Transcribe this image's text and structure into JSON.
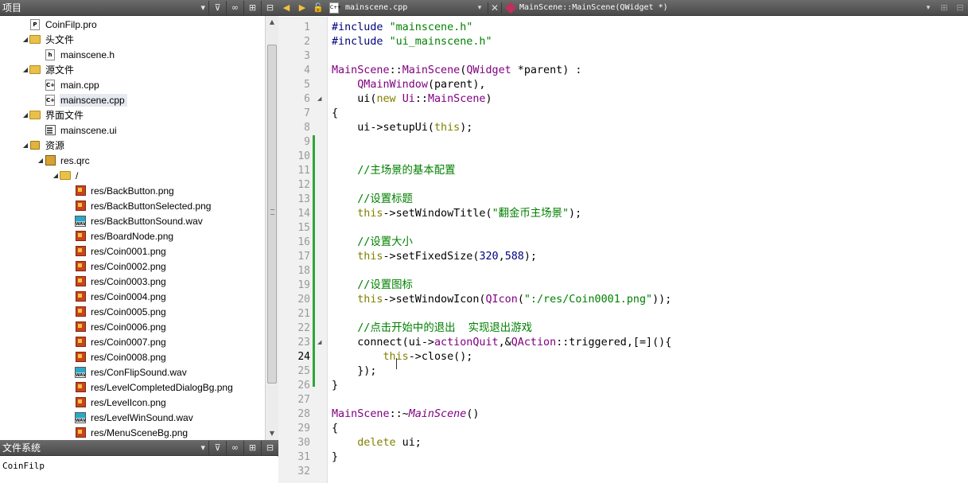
{
  "left_panel": {
    "project_title": "项目",
    "filesystem_title": "文件系统",
    "filesystem_path": "CoinFilp",
    "tree": [
      {
        "label": "CoinFilp.pro",
        "icon": "pro-file-icon",
        "depth": 0,
        "arrow": ""
      },
      {
        "label": "头文件",
        "icon": "header-folder-icon",
        "depth": 0,
        "arrow": "▲"
      },
      {
        "label": "mainscene.h",
        "icon": "header-file-icon",
        "depth": 1,
        "arrow": ""
      },
      {
        "label": "源文件",
        "icon": "source-folder-icon",
        "depth": 0,
        "arrow": "▲"
      },
      {
        "label": "main.cpp",
        "icon": "cpp-file-icon",
        "depth": 1,
        "arrow": ""
      },
      {
        "label": "mainscene.cpp",
        "icon": "cpp-file-icon",
        "depth": 1,
        "arrow": "",
        "selected": true
      },
      {
        "label": "界面文件",
        "icon": "forms-folder-icon",
        "depth": 0,
        "arrow": "▲"
      },
      {
        "label": "mainscene.ui",
        "icon": "ui-file-icon",
        "depth": 1,
        "arrow": ""
      },
      {
        "label": "资源",
        "icon": "resources-folder-icon",
        "depth": 0,
        "arrow": "▲"
      },
      {
        "label": "res.qrc",
        "icon": "qrc-file-icon",
        "depth": 1,
        "arrow": "▲"
      },
      {
        "label": "/",
        "icon": "folder-icon",
        "depth": 2,
        "arrow": "▲"
      },
      {
        "label": "res/BackButton.png",
        "icon": "png-file-icon",
        "depth": 3,
        "arrow": ""
      },
      {
        "label": "res/BackButtonSelected.png",
        "icon": "png-file-icon",
        "depth": 3,
        "arrow": ""
      },
      {
        "label": "res/BackButtonSound.wav",
        "icon": "wav-file-icon",
        "depth": 3,
        "arrow": ""
      },
      {
        "label": "res/BoardNode.png",
        "icon": "png-file-icon",
        "depth": 3,
        "arrow": ""
      },
      {
        "label": "res/Coin0001.png",
        "icon": "png-file-icon",
        "depth": 3,
        "arrow": ""
      },
      {
        "label": "res/Coin0002.png",
        "icon": "png-file-icon",
        "depth": 3,
        "arrow": ""
      },
      {
        "label": "res/Coin0003.png",
        "icon": "png-file-icon",
        "depth": 3,
        "arrow": ""
      },
      {
        "label": "res/Coin0004.png",
        "icon": "png-file-icon",
        "depth": 3,
        "arrow": ""
      },
      {
        "label": "res/Coin0005.png",
        "icon": "png-file-icon",
        "depth": 3,
        "arrow": ""
      },
      {
        "label": "res/Coin0006.png",
        "icon": "png-file-icon",
        "depth": 3,
        "arrow": ""
      },
      {
        "label": "res/Coin0007.png",
        "icon": "png-file-icon",
        "depth": 3,
        "arrow": ""
      },
      {
        "label": "res/Coin0008.png",
        "icon": "png-file-icon",
        "depth": 3,
        "arrow": ""
      },
      {
        "label": "res/ConFlipSound.wav",
        "icon": "wav-file-icon",
        "depth": 3,
        "arrow": ""
      },
      {
        "label": "res/LevelCompletedDialogBg.png",
        "icon": "png-file-icon",
        "depth": 3,
        "arrow": ""
      },
      {
        "label": "res/LevelIcon.png",
        "icon": "png-file-icon",
        "depth": 3,
        "arrow": ""
      },
      {
        "label": "res/LevelWinSound.wav",
        "icon": "wav-file-icon",
        "depth": 3,
        "arrow": ""
      },
      {
        "label": "res/MenuSceneBg.png",
        "icon": "png-file-icon",
        "depth": 3,
        "arrow": ""
      }
    ]
  },
  "editor": {
    "open_document": "mainscene.cpp",
    "current_symbol": "MainScene::MainScene(QWidget *)",
    "current_line": 24,
    "lines": [
      [
        [
          "pp",
          "#include "
        ],
        [
          "str",
          "\"mainscene.h\""
        ]
      ],
      [
        [
          "pp",
          "#include "
        ],
        [
          "str",
          "\"ui_mainscene.h\""
        ]
      ],
      [],
      [
        [
          "cls",
          "MainScene"
        ],
        [
          "fn",
          "::"
        ],
        [
          "cls",
          "MainScene"
        ],
        [
          "fn",
          "("
        ],
        [
          "cls",
          "QWidget"
        ],
        [
          "fn",
          " *parent) :"
        ]
      ],
      [
        [
          "fn",
          "    "
        ],
        [
          "cls",
          "QMainWindow"
        ],
        [
          "fn",
          "(parent),"
        ]
      ],
      [
        [
          "fn",
          "    ui("
        ],
        [
          "kw",
          "new"
        ],
        [
          "fn",
          " "
        ],
        [
          "cls",
          "Ui"
        ],
        [
          "fn",
          "::"
        ],
        [
          "cls",
          "MainScene"
        ],
        [
          "fn",
          ")"
        ]
      ],
      [
        [
          "fn",
          "{"
        ]
      ],
      [
        [
          "fn",
          "    ui->setupUi("
        ],
        [
          "kw",
          "this"
        ],
        [
          "fn",
          ");"
        ]
      ],
      [],
      [],
      [
        [
          "fn",
          "    "
        ],
        [
          "cmt",
          "//主场景的基本配置"
        ]
      ],
      [],
      [
        [
          "fn",
          "    "
        ],
        [
          "cmt",
          "//设置标题"
        ]
      ],
      [
        [
          "fn",
          "    "
        ],
        [
          "kw",
          "this"
        ],
        [
          "fn",
          "->setWindowTitle("
        ],
        [
          "str",
          "\"翻金币主场景\""
        ],
        [
          "fn",
          ");"
        ]
      ],
      [],
      [
        [
          "fn",
          "    "
        ],
        [
          "cmt",
          "//设置大小"
        ]
      ],
      [
        [
          "fn",
          "    "
        ],
        [
          "kw",
          "this"
        ],
        [
          "fn",
          "->setFixedSize("
        ],
        [
          "num",
          "320"
        ],
        [
          "fn",
          ","
        ],
        [
          "num",
          "588"
        ],
        [
          "fn",
          ");"
        ]
      ],
      [],
      [
        [
          "fn",
          "    "
        ],
        [
          "cmt",
          "//设置图标"
        ]
      ],
      [
        [
          "fn",
          "    "
        ],
        [
          "kw",
          "this"
        ],
        [
          "fn",
          "->setWindowIcon("
        ],
        [
          "cls",
          "QIcon"
        ],
        [
          "fn",
          "("
        ],
        [
          "str",
          "\":/res/Coin0001.png\""
        ],
        [
          "fn",
          "));"
        ]
      ],
      [],
      [
        [
          "fn",
          "    "
        ],
        [
          "cmt",
          "//点击开始中的退出  实现退出游戏"
        ]
      ],
      [
        [
          "fn",
          "    connect(ui->"
        ],
        [
          "cls",
          "actionQuit"
        ],
        [
          "fn",
          ",&"
        ],
        [
          "cls",
          "QAction"
        ],
        [
          "fn",
          "::triggered,[=](){"
        ]
      ],
      [
        [
          "fn",
          "        "
        ],
        [
          "kw",
          "this"
        ],
        [
          "fn",
          "->close();"
        ]
      ],
      [
        [
          "fn",
          "    });"
        ]
      ],
      [
        [
          "fn",
          "}"
        ]
      ],
      [],
      [
        [
          "cls",
          "MainScene"
        ],
        [
          "fn",
          "::~"
        ],
        [
          "cls it",
          "MainScene"
        ],
        [
          "fn",
          "()"
        ]
      ],
      [
        [
          "fn",
          "{"
        ]
      ],
      [
        [
          "fn",
          "    "
        ],
        [
          "kw",
          "delete"
        ],
        [
          "fn",
          " ui;"
        ]
      ],
      [
        [
          "fn",
          "}"
        ]
      ],
      []
    ],
    "fold_markers": [
      6,
      23
    ]
  }
}
